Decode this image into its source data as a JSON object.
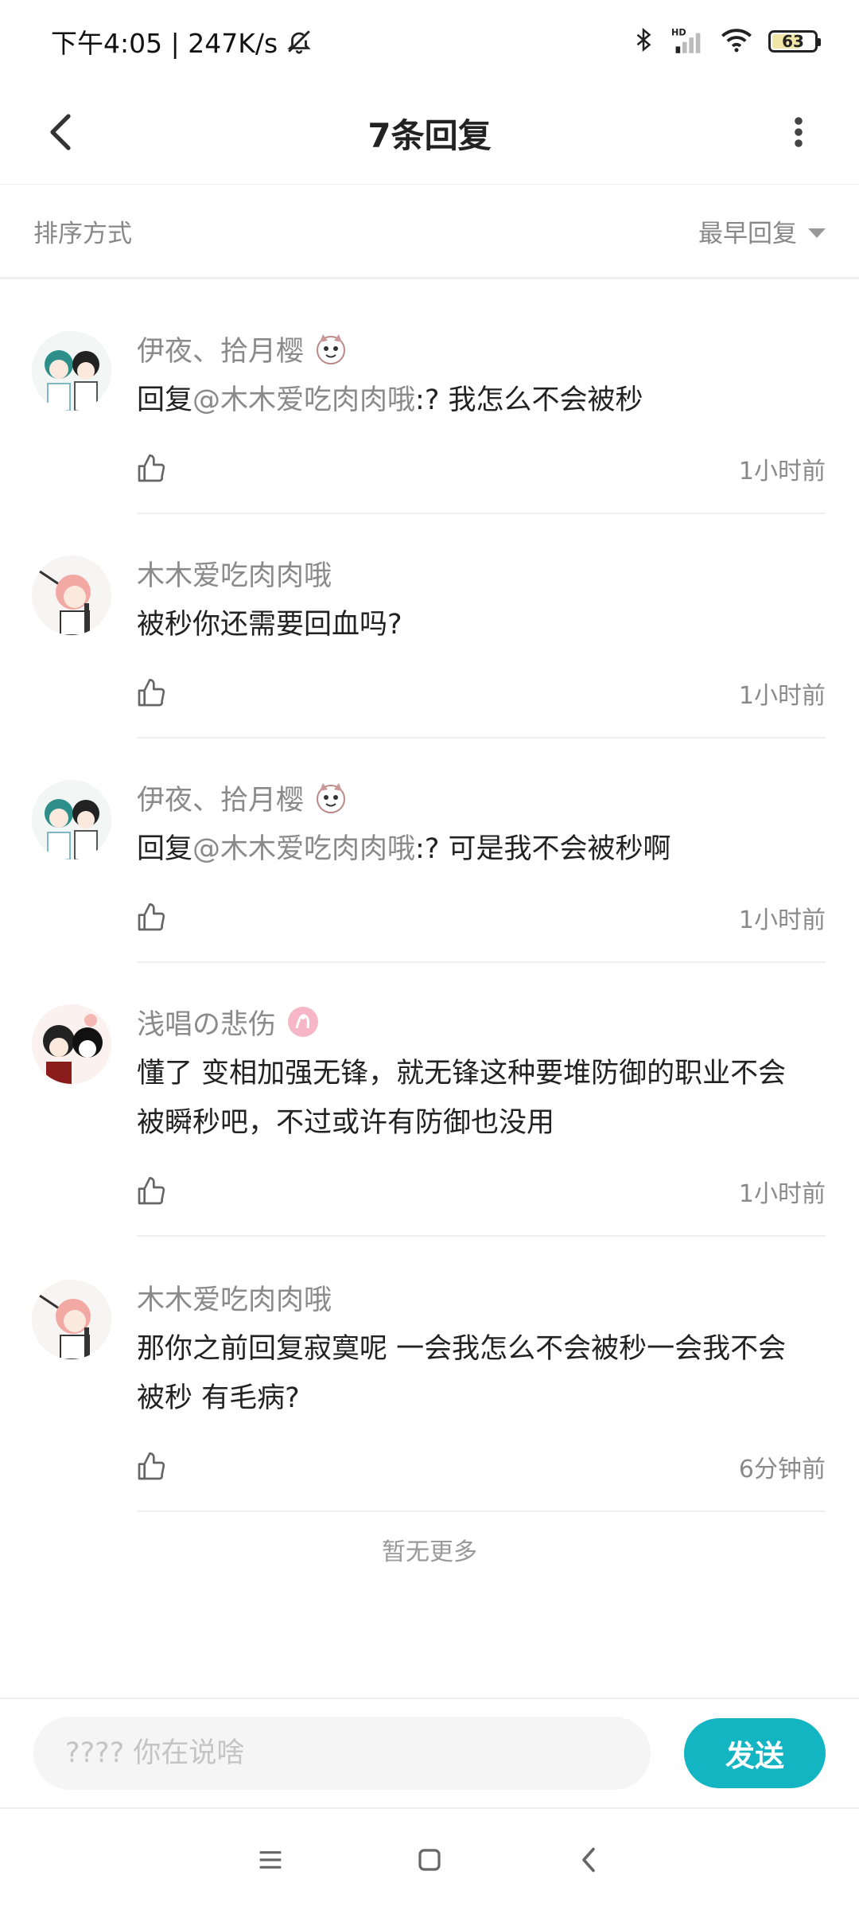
{
  "status_bar": {
    "time": "下午4:05 | 247K/s",
    "battery": "63",
    "battery_level": 0.63
  },
  "header": {
    "title": "7条回复"
  },
  "sort": {
    "label": "排序方式",
    "selected": "最早回复"
  },
  "replies": [
    {
      "username": "伊夜、拾月樱",
      "content_prefix": "回复",
      "mention": "@木木爱吃肉肉哦",
      "content": ":? 我怎么不会被秒",
      "time": "1小时前"
    },
    {
      "username": "木木爱吃肉肉哦",
      "content_prefix": "",
      "mention": "",
      "content": "被秒你还需要回血吗?",
      "time": "1小时前"
    },
    {
      "username": "伊夜、拾月樱",
      "content_prefix": "回复",
      "mention": "@木木爱吃肉肉哦",
      "content": ":? 可是我不会被秒啊",
      "time": "1小时前"
    },
    {
      "username": "浅唱の悲伤",
      "content_prefix": "",
      "mention": "",
      "content": "懂了 变相加强无锋，就无锋这种要堆防御的职业不会被瞬秒吧，不过或许有防御也没用",
      "time": "1小时前"
    },
    {
      "username": "木木爱吃肉肉哦",
      "content_prefix": "",
      "mention": "",
      "content": "那你之前回复寂寞呢 一会我怎么不会被秒一会我不会被秒 有毛病?",
      "time": "6分钟前"
    }
  ],
  "no_more": "暂无更多",
  "input": {
    "placeholder": "???? 你在说啥",
    "value": "",
    "send_label": "发送"
  },
  "colors": {
    "accent": "#13b5c2",
    "muted_text": "#8a8a8a"
  }
}
